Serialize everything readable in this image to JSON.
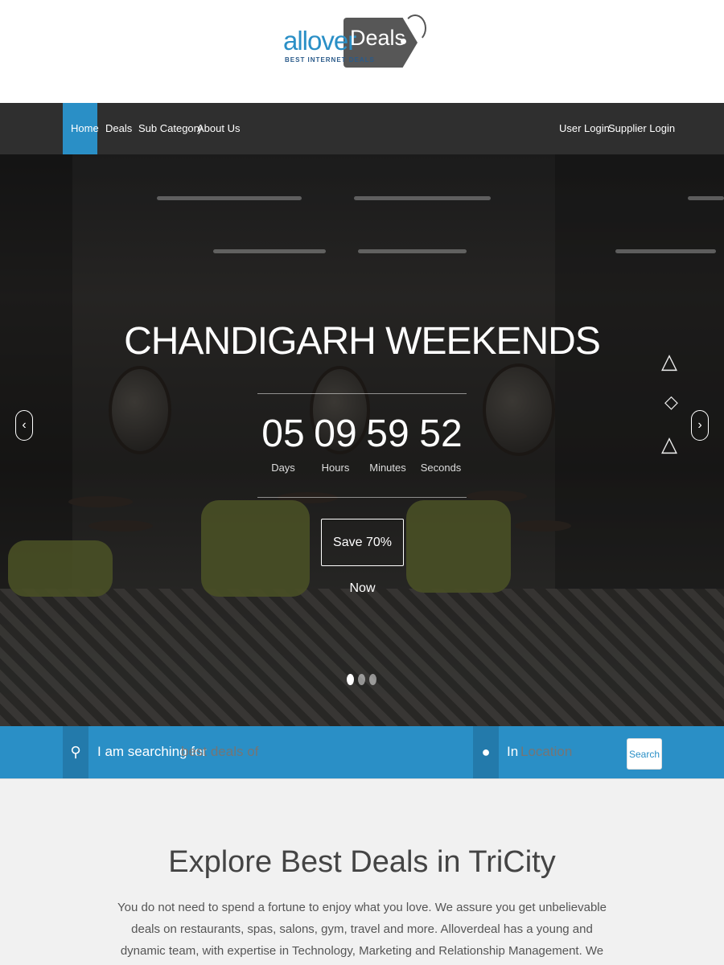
{
  "logo": {
    "word": "allover",
    "tag": "Deals",
    "subtitle": "BEST INTERNET DEALS"
  },
  "nav": {
    "left": [
      {
        "label": "Home",
        "active": true
      },
      {
        "label": "Deals",
        "active": false
      },
      {
        "label": "Sub Category",
        "active": false
      },
      {
        "label": "About Us",
        "active": false
      }
    ],
    "right": [
      {
        "label": "User Login"
      },
      {
        "label": "Supplier Login"
      }
    ]
  },
  "hero": {
    "title": "CHANDIGARH WEEKENDS",
    "countdown": [
      {
        "value": "05",
        "label": "Days"
      },
      {
        "value": "09",
        "label": "Hours"
      },
      {
        "value": "59",
        "label": "Minutes"
      },
      {
        "value": "52",
        "label": "Seconds"
      }
    ],
    "cta_label": "Save 70% Now",
    "prev_icon": "chevron-left-icon",
    "next_icon": "chevron-right-icon",
    "slides": 3,
    "active_slide": 1
  },
  "search": {
    "search_label": "I am searching for",
    "search_placeholder": "best deals of",
    "location_label": "In",
    "location_placeholder": "Location",
    "button_label": "Search",
    "accent": "#2a8fc6"
  },
  "explore": {
    "title": "Explore Best Deals in TriCity",
    "text": "You do not need to spend a fortune to enjoy what you love. We assure you get unbelievable deals on restaurants, spas, salons, gym, travel and more. Alloverdeal has a young and dynamic team, with expertise in Technology, Marketing and Relationship Management. We believe in creating a \"WOW\" for our customers through the best of services. Our team is comprised of"
  }
}
